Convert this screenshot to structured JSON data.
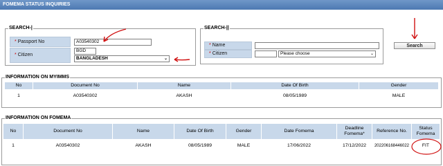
{
  "title": "FOMEMA STATUS INQUIRIES",
  "search_left": {
    "legend": "SEARCH-|",
    "passport_label": "Passport No",
    "passport_value": "A03540302",
    "citizen_label": "Citizen",
    "citizen_code": "BGD",
    "citizen_value": "BANGLADESH",
    "required_mark": "*"
  },
  "search_right": {
    "legend": "SEARCH-||",
    "name_label": "Name",
    "name_value": "",
    "citizen_label": "Citizen",
    "citizen_code": "",
    "citizen_value": "Please choose",
    "required_mark": "*"
  },
  "search_button": "Search",
  "myimms": {
    "legend": "INFORMATION ON MYIMMS",
    "headers": [
      "No",
      "Document No",
      "Name",
      "Date Of Birth",
      "Gender"
    ],
    "rows": [
      [
        "1",
        "A03540302",
        "AKASH",
        "08/05/1989",
        "MALE"
      ]
    ]
  },
  "fomema": {
    "legend": "INFORMATION ON FOMEMA",
    "headers": [
      "No",
      "Document No",
      "Name",
      "Date Of Birth",
      "Gender",
      "Date Fomema",
      "Deadline Fomema*",
      "Reference No.",
      "Status Fomema"
    ],
    "rows": [
      [
        "1",
        "A03540302",
        "AKASH",
        "08/05/1989",
        "MALE",
        "17/06/2022",
        "17/12/2022",
        "202206168446022",
        "FIT"
      ]
    ]
  },
  "icons": {
    "select_chevron": "chevron-down-icon",
    "annotation_arrow": "red-arrow-icon",
    "annotation_circle": "red-circle-icon"
  },
  "colors": {
    "title_bar": "#5b84bb",
    "label_bg": "#c8d8ea",
    "annotation": "#d01010"
  }
}
